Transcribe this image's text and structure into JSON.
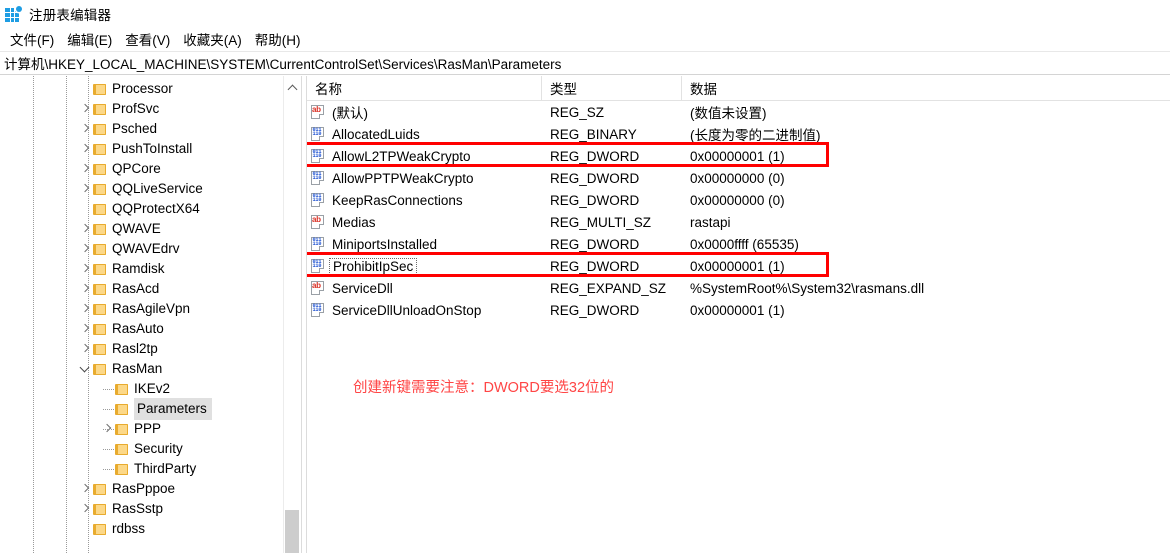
{
  "window": {
    "title": "注册表编辑器",
    "icon": "registry-editor-icon"
  },
  "menubar": {
    "items": [
      {
        "label": "文件(F)"
      },
      {
        "label": "编辑(E)"
      },
      {
        "label": "查看(V)"
      },
      {
        "label": "收藏夹(A)"
      },
      {
        "label": "帮助(H)"
      }
    ]
  },
  "address": {
    "path": "计算机\\HKEY_LOCAL_MACHINE\\SYSTEM\\CurrentControlSet\\Services\\RasMan\\Parameters"
  },
  "tree": {
    "items": [
      {
        "label": "Processor",
        "depth": 3,
        "twisty": "none",
        "selected": false
      },
      {
        "label": "ProfSvc",
        "depth": 3,
        "twisty": "closed",
        "selected": false
      },
      {
        "label": "Psched",
        "depth": 3,
        "twisty": "closed",
        "selected": false
      },
      {
        "label": "PushToInstall",
        "depth": 3,
        "twisty": "closed",
        "selected": false
      },
      {
        "label": "QPCore",
        "depth": 3,
        "twisty": "closed",
        "selected": false
      },
      {
        "label": "QQLiveService",
        "depth": 3,
        "twisty": "closed",
        "selected": false
      },
      {
        "label": "QQProtectX64",
        "depth": 3,
        "twisty": "none",
        "selected": false
      },
      {
        "label": "QWAVE",
        "depth": 3,
        "twisty": "closed",
        "selected": false
      },
      {
        "label": "QWAVEdrv",
        "depth": 3,
        "twisty": "closed",
        "selected": false
      },
      {
        "label": "Ramdisk",
        "depth": 3,
        "twisty": "closed",
        "selected": false
      },
      {
        "label": "RasAcd",
        "depth": 3,
        "twisty": "closed",
        "selected": false
      },
      {
        "label": "RasAgileVpn",
        "depth": 3,
        "twisty": "closed",
        "selected": false
      },
      {
        "label": "RasAuto",
        "depth": 3,
        "twisty": "closed",
        "selected": false
      },
      {
        "label": "Rasl2tp",
        "depth": 3,
        "twisty": "closed",
        "selected": false
      },
      {
        "label": "RasMan",
        "depth": 3,
        "twisty": "open",
        "selected": false
      },
      {
        "label": "IKEv2",
        "depth": 4,
        "twisty": "none",
        "selected": false
      },
      {
        "label": "Parameters",
        "depth": 4,
        "twisty": "none",
        "selected": true
      },
      {
        "label": "PPP",
        "depth": 4,
        "twisty": "closed",
        "selected": false
      },
      {
        "label": "Security",
        "depth": 4,
        "twisty": "none",
        "selected": false
      },
      {
        "label": "ThirdParty",
        "depth": 4,
        "twisty": "none",
        "selected": false
      },
      {
        "label": "RasPppoe",
        "depth": 3,
        "twisty": "closed",
        "selected": false
      },
      {
        "label": "RasSstp",
        "depth": 3,
        "twisty": "closed",
        "selected": false
      },
      {
        "label": "rdbss",
        "depth": 3,
        "twisty": "none",
        "selected": false
      }
    ]
  },
  "list": {
    "columns": [
      {
        "label": "名称"
      },
      {
        "label": "类型"
      },
      {
        "label": "数据"
      }
    ],
    "rows": [
      {
        "icon": "string-value-icon",
        "name": "(默认)",
        "type": "REG_SZ",
        "data": "(数值未设置)",
        "highlight": false,
        "focus": false
      },
      {
        "icon": "binary-value-icon",
        "name": "AllocatedLuids",
        "type": "REG_BINARY",
        "data": "(长度为零的二进制值)",
        "highlight": false,
        "focus": false
      },
      {
        "icon": "binary-value-icon",
        "name": "AllowL2TPWeakCrypto",
        "type": "REG_DWORD",
        "data": "0x00000001 (1)",
        "highlight": true,
        "focus": false
      },
      {
        "icon": "binary-value-icon",
        "name": "AllowPPTPWeakCrypto",
        "type": "REG_DWORD",
        "data": "0x00000000 (0)",
        "highlight": false,
        "focus": false
      },
      {
        "icon": "binary-value-icon",
        "name": "KeepRasConnections",
        "type": "REG_DWORD",
        "data": "0x00000000 (0)",
        "highlight": false,
        "focus": false
      },
      {
        "icon": "string-value-icon",
        "name": "Medias",
        "type": "REG_MULTI_SZ",
        "data": "rastapi",
        "highlight": false,
        "focus": false
      },
      {
        "icon": "binary-value-icon",
        "name": "MiniportsInstalled",
        "type": "REG_DWORD",
        "data": "0x0000ffff (65535)",
        "highlight": false,
        "focus": false
      },
      {
        "icon": "binary-value-icon",
        "name": "ProhibitIpSec",
        "type": "REG_DWORD",
        "data": "0x00000001 (1)",
        "highlight": true,
        "focus": true
      },
      {
        "icon": "string-value-icon",
        "name": "ServiceDll",
        "type": "REG_EXPAND_SZ",
        "data": "%SystemRoot%\\System32\\rasmans.dll",
        "highlight": false,
        "focus": false
      },
      {
        "icon": "binary-value-icon",
        "name": "ServiceDllUnloadOnStop",
        "type": "REG_DWORD",
        "data": "0x00000001 (1)",
        "highlight": false,
        "focus": false
      }
    ]
  },
  "annotation": {
    "text": "创建新键需要注意：DWORD要选32位的",
    "color": "#ff4545"
  },
  "colors": {
    "highlight_box": "#ff0000",
    "selection": "#e0e0e0",
    "folder": "#fcd888"
  }
}
